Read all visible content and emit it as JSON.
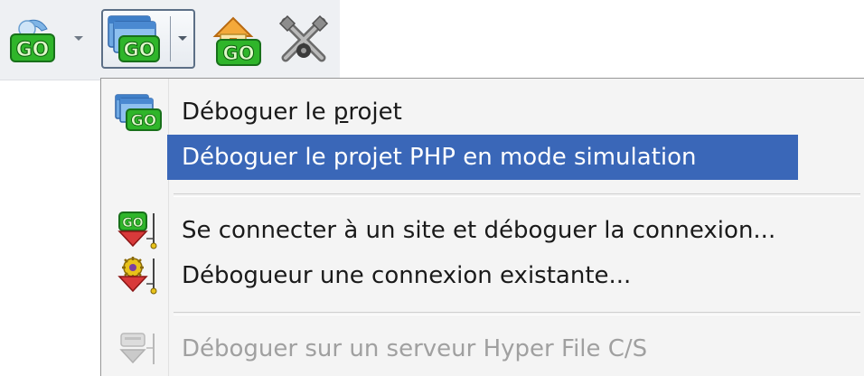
{
  "toolbar": {
    "buttons": [
      {
        "name": "go-button",
        "icon": "go-green-icon",
        "has_dropdown": true,
        "pressed": false
      },
      {
        "name": "debug-project-split-button",
        "icon": "windows-go-icon",
        "has_dropdown": true,
        "pressed": true
      },
      {
        "name": "go-home-button",
        "icon": "house-go-icon",
        "has_dropdown": false,
        "pressed": false
      },
      {
        "name": "stop-debug-button",
        "icon": "crossed-tools-icon",
        "has_dropdown": false,
        "pressed": false
      }
    ]
  },
  "menu": {
    "items": [
      {
        "label_before": "Déboguer le ",
        "label_mnemonic": "p",
        "label_after": "rojet",
        "icon": "windows-go-icon",
        "selected": false,
        "disabled": false
      },
      {
        "label": "Déboguer le projet PHP en mode simulation",
        "icon": "",
        "selected": true,
        "disabled": false
      },
      {
        "label": "Se connecter à un site et déboguer la connexion...",
        "icon": "go-debug-connect-icon",
        "selected": false,
        "disabled": false
      },
      {
        "label": "Débogueur une connexion existante...",
        "icon": "gear-debug-connect-icon",
        "selected": false,
        "disabled": false
      },
      {
        "label": "Déboguer sur un serveur Hyper File C/S",
        "icon": "server-debug-icon",
        "selected": false,
        "disabled": true
      }
    ]
  },
  "colors": {
    "selection": "#3a67b8",
    "menu_background": "#f4f4f4",
    "toolbar_background": "#eef0f3",
    "go_green": "#2fb52a",
    "disabled_text": "#a0a0a0"
  }
}
